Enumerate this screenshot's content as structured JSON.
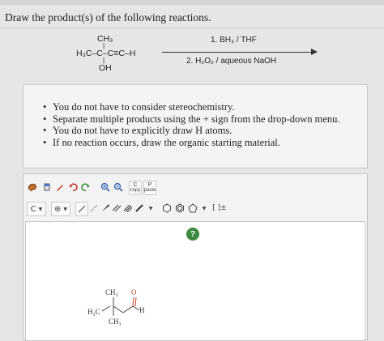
{
  "question": "Draw the product(s) of the following reactions.",
  "reactant": {
    "top": "CH₃",
    "main": "H₃C–C–C≡C–H",
    "bottom": "OH"
  },
  "reagents": {
    "step1": "1. BH₃ / THF",
    "step2": "2. H₂O₂ / aqueous NaOH"
  },
  "instructions": [
    "You do not have to consider stereochemistry.",
    "Separate multiple products using the + sign from the drop-down menu.",
    "You do not have to explicitly draw H atoms.",
    "If no reaction occurs, draw the organic starting material."
  ],
  "toolbar": {
    "copy_top": "C",
    "copy_sub": "copy",
    "paste_top": "P",
    "paste_sub": "paste",
    "atom_select": "C",
    "bracket_label": "[ ]±"
  },
  "editor": {
    "help": "?",
    "drawn": {
      "ch3_top": "CH₃",
      "o": "O",
      "h3c": "H₃C",
      "h": "H",
      "ch3_bottom": "CH₃"
    }
  },
  "colors": {
    "help_green": "#3a8a3f",
    "carbonyl_red": "#c0392b"
  }
}
